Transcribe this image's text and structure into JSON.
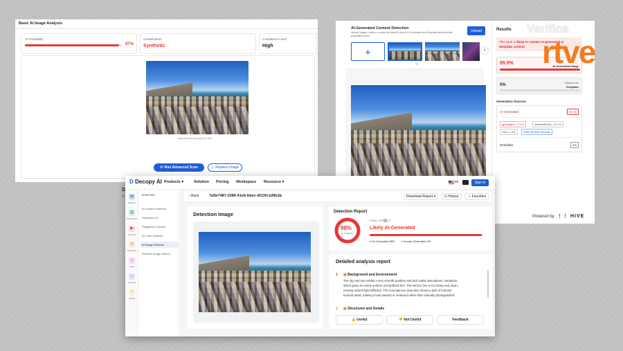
{
  "colors": {
    "red": "#e53935",
    "blue": "#1f5fd6",
    "green": "#2fa84f",
    "rtve_orange": "#f47c20"
  },
  "w1": {
    "title": "Basic AI Image Analysis",
    "ai_probability_label": "AI Probability",
    "ai_probability_value": "97%",
    "ai_probability": 0.97,
    "classification_label": "Classification",
    "classification_value": "Synthetic",
    "confidence_label": "Confidence Level",
    "confidence_value": "High",
    "filename": "Hzjbzqa1104A-ocrv.jpg 22/4 983",
    "run_button": "Run Advanced Scan",
    "replace_button": "Replace Image",
    "side_peek": "D",
    "side_peek2": "In"
  },
  "w2": {
    "header_title": "AI-Generated Content Detection",
    "header_desc1": "Upload images, videos, or audio for frame-by-frame AI-Generated and Deepfake detection with",
    "header_desc2": "probability scores.",
    "upload_button": "Upload",
    "add_icon": "plus-icon",
    "results_title": "Results",
    "alert_pre": "This input is",
    "alert_bold": "likely to contain AI-generated or",
    "alert_line2": "deepfake content",
    "ai_pct": "99.9%",
    "ai_label": "AI-Generated Image",
    "ai_value": 0.999,
    "deep_pct": "0%",
    "deep_label1": "Likely to be",
    "deep_label2": "Deepfake",
    "deep_value": 0.0,
    "sources_title": "Generation Sources",
    "ai_generated_label": "AI-Generated",
    "ai_generated_value": "99.9%",
    "tags": [
      "gptimage2: 77.1%",
      "stablediffusion: 13.1%",
      "Hutu: 1.5%",
      "View 99 More Results"
    ],
    "deepfake_label": "Deepfake",
    "deepfake_value": "0%",
    "powered_by": "Powered by",
    "hive": "HIVE"
  },
  "brand": {
    "line1": "Verifica",
    "line2": "rtve"
  },
  "w3": {
    "logo": "Decopy AI",
    "nav": [
      "Products",
      "Solution",
      "Pricing",
      "Workspace",
      "Resource"
    ],
    "lang": "en",
    "signin": "Sign In",
    "side_icons": [
      {
        "label": "Detector",
        "icon": "document-icon"
      },
      {
        "label": "Summarizer",
        "icon": "summary-icon"
      },
      {
        "label": "YouTube",
        "icon": "youtube-icon"
      },
      {
        "label": "Transcriber",
        "icon": "transcribe-icon"
      },
      {
        "label": "Audio",
        "icon": "audio-icon"
      },
      {
        "label": "Learning",
        "icon": "book-icon"
      },
      {
        "label": "Writing",
        "icon": "pen-icon"
      }
    ],
    "menu_title": "Detection",
    "menu": [
      "AI Content Detector",
      "Humanize AI",
      "Plagiarism Checker",
      "AI Code Detector",
      "AI Image Detector",
      "Reverse Image Search"
    ],
    "back": "Back",
    "doc_id": "7a5b7487-2380-41e6-bbec-df13fc1d9b1b",
    "download": "Download Report",
    "history": "History",
    "favorites": "Favorites",
    "detection_image_title": "Detection Image",
    "report_title": "Detection Report",
    "score": "98%",
    "score_value": 0.98,
    "score_sub": "AI Probability",
    "final_verdict": "FINAL VERDICT",
    "verdict": "Likely AI-Generated",
    "legend_ai": "AI Generated 98%",
    "legend_human": "Human Generated 2%",
    "detailed_title": "Detailed analysis report",
    "s1_num": "1",
    "s1_title": "Background and Environment",
    "s1_lines": [
      "The sky and sea exhibit a very smooth gradient and lack subtle atmospheric variations,",
      "which gives an overly uniform and artificial feel. The horizon line is too sharp and clean,",
      "missing natural light diffusion. The mountainous area also shows a lack of intricate",
      "textural detail, making it look painted or rendered rather than naturally photographed."
    ],
    "s2_num": "2",
    "s2_title": "Structures and Details",
    "useful": "Useful",
    "not_useful": "Not Useful",
    "feedback": "Feedback"
  }
}
